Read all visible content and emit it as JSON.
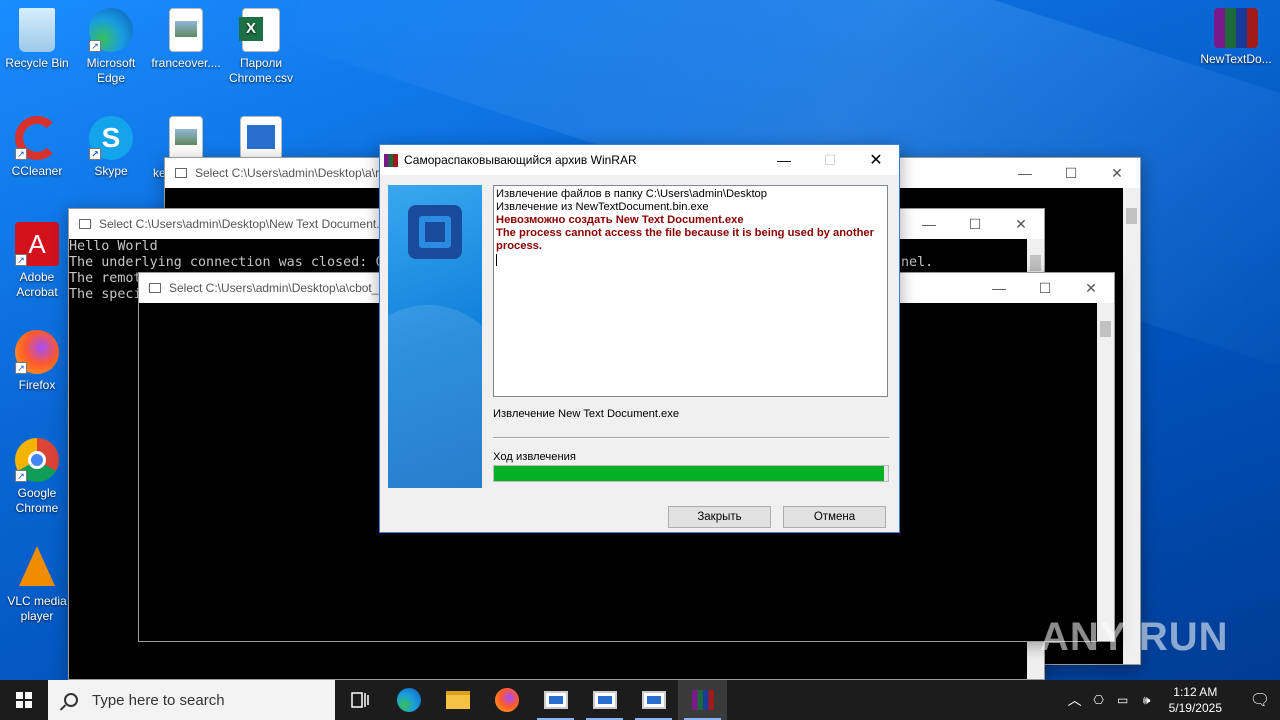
{
  "desktop": {
    "icons": [
      {
        "label": "Recycle Bin"
      },
      {
        "label": "Microsoft Edge"
      },
      {
        "label": "franceover...."
      },
      {
        "label": "Пароли Chrome.csv"
      },
      {
        "label": "CCleaner"
      },
      {
        "label": "Skype"
      },
      {
        "label": "ke"
      },
      {
        "label": "Adobe Acrobat"
      },
      {
        "label": "Firefox"
      },
      {
        "label": "Google Chrome"
      },
      {
        "label": "VLC media player"
      },
      {
        "label": "NewTextDo..."
      }
    ]
  },
  "consoles": {
    "back_title": "Select C:\\Users\\admin\\Desktop\\a\\r",
    "mid_title": "Select C:\\Users\\admin\\Desktop\\New Text Document.",
    "front_title": "Select C:\\Users\\admin\\Desktop\\a\\cbot_",
    "lines": [
      "Hello World",
      "The underlying connection was closed: C",
      "The remot",
      "The speci"
    ],
    "line2_tail": "nel."
  },
  "winrar": {
    "title": "Самораспаковывающийся архив WinRAR",
    "log": {
      "line1": "Извлечение файлов в папку C:\\Users\\admin\\Desktop",
      "line2": "Извлечение из NewTextDocument.bin.exe",
      "error1": "Невозможно создать New Text Document.exe",
      "error2": "The process cannot access the file because it is being used by another process."
    },
    "status": "Извлечение New Text Document.exe",
    "progress_label": "Ход извлечения",
    "progress": 0.99,
    "close_button": "Закрыть",
    "cancel_button": "Отмена"
  },
  "taskbar": {
    "search_placeholder": "Type here to search",
    "time": "1:12 AM",
    "date": "5/19/2025"
  },
  "watermark": "ANY RUN"
}
